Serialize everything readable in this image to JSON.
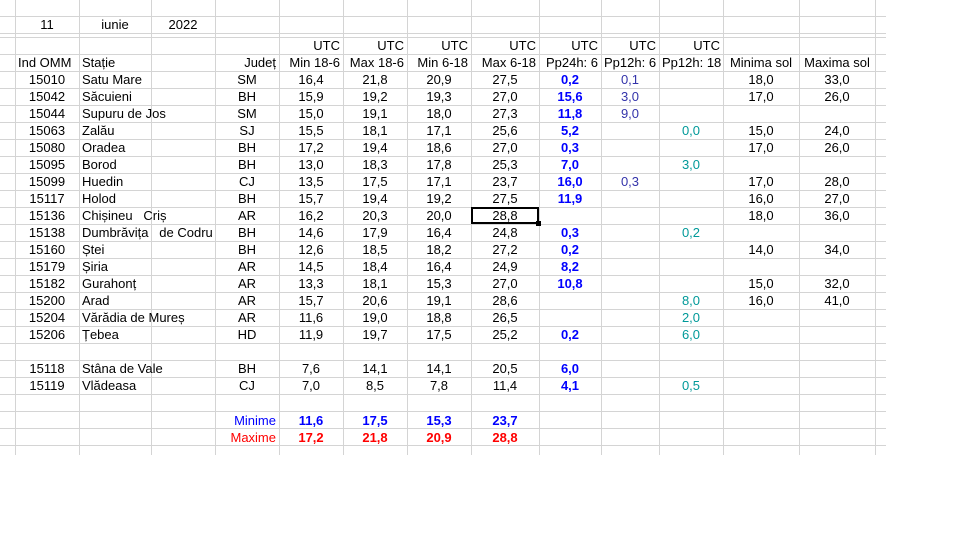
{
  "date": {
    "day": "11",
    "month": "iunie",
    "year": "2022"
  },
  "utc_labels": [
    "UTC",
    "UTC",
    "UTC",
    "UTC",
    "UTC",
    "UTC",
    "UTC"
  ],
  "headers": [
    "Ind OMM",
    "Stație",
    "Județ",
    "Min 18-6",
    "Max 18-6",
    "Min 6-18",
    "Max 6-18",
    "Pp24h: 6",
    "Pp12h: 6",
    "Pp12h: 18",
    "Minima sol",
    "Maxima sol"
  ],
  "rows": [
    [
      "15010",
      "Satu Mare",
      "SM",
      "16,4",
      "21,8",
      "20,9",
      "27,5",
      "0,2",
      "0,1",
      "",
      "18,0",
      "33,0"
    ],
    [
      "15042",
      "Săcuieni",
      "BH",
      "15,9",
      "19,2",
      "19,3",
      "27,0",
      "15,6",
      "3,0",
      "",
      "17,0",
      "26,0"
    ],
    [
      "15044",
      "Supuru de Jos",
      "SM",
      "15,0",
      "19,1",
      "18,0",
      "27,3",
      "11,8",
      "9,0",
      "",
      "",
      ""
    ],
    [
      "15063",
      "Zalău",
      "SJ",
      "15,5",
      "18,1",
      "17,1",
      "25,6",
      "5,2",
      "",
      "0,0",
      "15,0",
      "24,0"
    ],
    [
      "15080",
      "Oradea",
      "BH",
      "17,2",
      "19,4",
      "18,6",
      "27,0",
      "0,3",
      "",
      "",
      "17,0",
      "26,0"
    ],
    [
      "15095",
      "Borod",
      "BH",
      "13,0",
      "18,3",
      "17,8",
      "25,3",
      "7,0",
      "",
      "3,0",
      "",
      ""
    ],
    [
      "15099",
      "Huedin",
      "CJ",
      "13,5",
      "17,5",
      "17,1",
      "23,7",
      "16,0",
      "0,3",
      "",
      "17,0",
      "28,0"
    ],
    [
      "15117",
      "Holod",
      "BH",
      "15,7",
      "19,4",
      "19,2",
      "27,5",
      "11,9",
      "",
      "",
      "16,0",
      "27,0"
    ],
    [
      "15136",
      "Chișineu   Criș",
      "AR",
      "16,2",
      "20,3",
      "20,0",
      "28,8",
      "",
      "",
      "",
      "18,0",
      "36,0"
    ],
    [
      "15138",
      "Dumbrăvița   de Codru",
      "BH",
      "14,6",
      "17,9",
      "16,4",
      "24,8",
      "0,3",
      "",
      "0,2",
      "",
      ""
    ],
    [
      "15160",
      "Ștei",
      "BH",
      "12,6",
      "18,5",
      "18,2",
      "27,2",
      "0,2",
      "",
      "",
      "14,0",
      "34,0"
    ],
    [
      "15179",
      "Șiria",
      "AR",
      "14,5",
      "18,4",
      "16,4",
      "24,9",
      "8,2",
      "",
      "",
      "",
      ""
    ],
    [
      "15182",
      "Gurahonț",
      "AR",
      "13,3",
      "18,1",
      "15,3",
      "27,0",
      "10,8",
      "",
      "",
      "15,0",
      "32,0"
    ],
    [
      "15200",
      "Arad",
      "AR",
      "15,7",
      "20,6",
      "19,1",
      "28,6",
      "",
      "",
      "8,0",
      "16,0",
      "41,0"
    ],
    [
      "15204",
      "Vărădia de Mureș",
      "AR",
      "11,6",
      "19,0",
      "18,8",
      "26,5",
      "",
      "",
      "2,0",
      "",
      ""
    ],
    [
      "15206",
      "Țebea",
      "HD",
      "11,9",
      "19,7",
      "17,5",
      "25,2",
      "0,2",
      "",
      "6,0",
      "",
      ""
    ],
    [
      "",
      "",
      "",
      "",
      "",
      "",
      "",
      "",
      "",
      "",
      "",
      ""
    ],
    [
      "15118",
      "Stâna de Vale",
      "BH",
      "7,6",
      "14,1",
      "14,1",
      "20,5",
      "6,0",
      "",
      "",
      "",
      ""
    ],
    [
      "15119",
      "Vlădeasa",
      "CJ",
      "7,0",
      "8,5",
      "7,8",
      "11,4",
      "4,1",
      "",
      "0,5",
      "",
      ""
    ]
  ],
  "minime": {
    "label": "Minime",
    "values": [
      "11,6",
      "17,5",
      "15,3",
      "23,7"
    ]
  },
  "maxime": {
    "label": "Maxime",
    "values": [
      "17,2",
      "21,8",
      "20,9",
      "28,8"
    ]
  },
  "colors": {
    "blue": "#0000ff",
    "red": "#ff0000",
    "teal": "#009999",
    "grid": "#d4d4d4"
  },
  "selected_cell": "15136 / Max 6-18"
}
